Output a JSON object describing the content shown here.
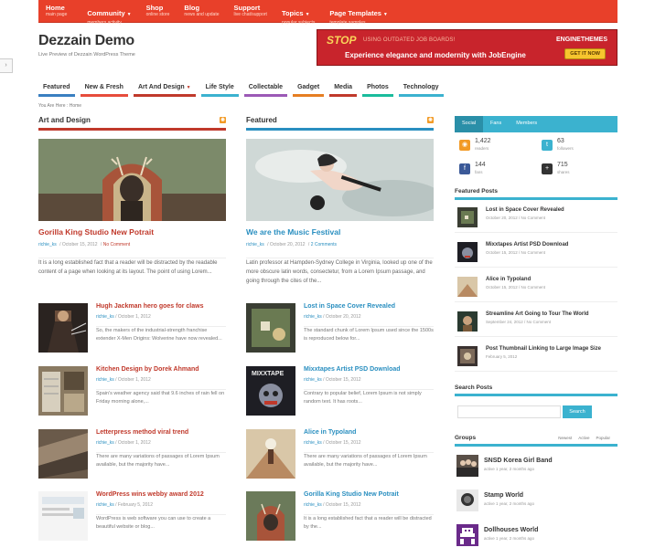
{
  "topnav": [
    {
      "t": "Home",
      "s": "main page"
    },
    {
      "t": "Community",
      "s": "members activity",
      "caret": true
    },
    {
      "t": "Shop",
      "s": "online store"
    },
    {
      "t": "Blog",
      "s": "news and update"
    },
    {
      "t": "Support",
      "s": "live chat/support"
    },
    {
      "t": "Topics",
      "s": "popular subjects",
      "caret": true
    },
    {
      "t": "Page Templates",
      "s": "template samples",
      "caret": true
    }
  ],
  "site": {
    "title": "Dezzain Demo",
    "tagline": "Live Preview of Dezzain WordPress Theme"
  },
  "banner": {
    "stop": "STOP",
    "stop_sub": "using outdated job boards!",
    "experience": "Experience elegance and modernity with JobEngine",
    "brand": "ENGINETHEMES",
    "cta": "GET IT NOW"
  },
  "sidetab": "›",
  "catnav": [
    {
      "label": "Featured",
      "color": "#3a7fc1"
    },
    {
      "label": "New & Fresh",
      "color": "#e74c3c"
    },
    {
      "label": "Art And Design",
      "color": "#c0392b",
      "caret": true
    },
    {
      "label": "Life Style",
      "color": "#3bb2cf"
    },
    {
      "label": "Collectable",
      "color": "#9b59b6"
    },
    {
      "label": "Gadget",
      "color": "#e67e22"
    },
    {
      "label": "Media",
      "color": "#c0392b"
    },
    {
      "label": "Photos",
      "color": "#1abc9c"
    },
    {
      "label": "Technology",
      "color": "#3bb2cf"
    }
  ],
  "breadcrumb": "You Are Here : Home",
  "left": {
    "heading": "Art and Design",
    "featured": {
      "title": "Gorilla King Studio New Potrait",
      "author": "richie_ks",
      "date": "October 15, 2012",
      "comments": "No Comment",
      "excerpt": "It is a long established fact that a reader will be distracted by the readable content of a page when looking at its layout. The point of using Lorem..."
    },
    "items": [
      {
        "title": "Hugh Jackman hero goes for claws",
        "author": "richie_ks",
        "date": "October 1, 2012",
        "excerpt": "So, the makers of the industrial-strength franchise extender X-Men Origins: Wolverine have now revealed..."
      },
      {
        "title": "Kitchen Design by Dorek Ahmand",
        "author": "richie_ks",
        "date": "October 1, 2012",
        "excerpt": "Spain's weather agency said that 9.6 inches of rain fell on Friday morning alone,..."
      },
      {
        "title": "Letterpress method viral trend",
        "author": "richie_ks",
        "date": "October 1, 2012",
        "excerpt": "There are many variations of passages of Lorem Ipsum available, but the majority have..."
      },
      {
        "title": "WordPress wins webby award 2012",
        "author": "richie_ks",
        "date": "February 5, 2012",
        "excerpt": "WordPress is web software you can use to create a beautiful website or blog..."
      }
    ]
  },
  "mid": {
    "heading": "Featured",
    "featured": {
      "title": "We are the Music Festival",
      "author": "richie_ks",
      "date": "October 20, 2012",
      "comments": "2 Comments",
      "excerpt": "Latin professor at Hampden-Sydney College in Virginia, looked up one of the more obscure latin words, consectetur, from a Lorem Ipsum passage, and going through the cites of the..."
    },
    "items": [
      {
        "title": "Lost in Space Cover Revealed",
        "author": "richie_ks",
        "date": "October 20, 2012",
        "excerpt": "The standard chunk of Lorem Ipsum used since the 1500s is reproduced below for..."
      },
      {
        "title": "Mixxtapes Artist PSD Download",
        "author": "richie_ks",
        "date": "October 15, 2012",
        "excerpt": "Contrary to popular belief, Lorem Ipsum is not simply random text. It has roots..."
      },
      {
        "title": "Alice in Typoland",
        "author": "richie_ks",
        "date": "October 15, 2012",
        "excerpt": "There are many variations of passages of Lorem Ipsum available, but the majority have..."
      },
      {
        "title": "Gorilla King Studio New Potrait",
        "author": "richie_ks",
        "date": "October 15, 2012",
        "excerpt": "It is a long established fact that a reader will be distracted by the..."
      }
    ]
  },
  "sidebar": {
    "tabs": [
      "Social",
      "Fans",
      "Members"
    ],
    "social": [
      {
        "n": "1,422",
        "l": "readers",
        "color": "#f29a25",
        "icon": "rss-icon",
        "glyph": "◉"
      },
      {
        "n": "63",
        "l": "followers",
        "color": "#3bb2cf",
        "icon": "twitter-icon",
        "glyph": "t"
      },
      {
        "n": "144",
        "l": "fans",
        "color": "#3b5998",
        "icon": "facebook-icon",
        "glyph": "f"
      },
      {
        "n": "715",
        "l": "shares",
        "color": "#333333",
        "icon": "plus-icon",
        "glyph": "+"
      }
    ],
    "featured_heading": "Featured Posts",
    "featured_posts": [
      {
        "t": "Lost in Space Cover Revealed",
        "d": "October 20, 2012",
        "c": "No Comment"
      },
      {
        "t": "Mixxtapes Artist PSD Download",
        "d": "October 15, 2012",
        "c": "No Comment"
      },
      {
        "t": "Alice in Typoland",
        "d": "October 15, 2012",
        "c": "No Comment"
      },
      {
        "t": "Streamline Art Going to Tour The World",
        "d": "September 24, 2012",
        "c": "No Comment"
      },
      {
        "t": "Post Thumbnail Linking to Large Image Size",
        "d": "February 5, 2012",
        "c": ""
      }
    ],
    "search_heading": "Search Posts",
    "search_btn": "Search",
    "groups_heading": "Groups",
    "group_tabs": [
      "Newest",
      "Active",
      "Popular"
    ],
    "groups": [
      {
        "t": "SNSD Korea Girl Band",
        "m": "active 1 year, 2 months ago"
      },
      {
        "t": "Stamp World",
        "m": "active 1 year, 2 months ago"
      },
      {
        "t": "Dollhouses World",
        "m": "active 1 year, 2 months ago"
      }
    ]
  }
}
